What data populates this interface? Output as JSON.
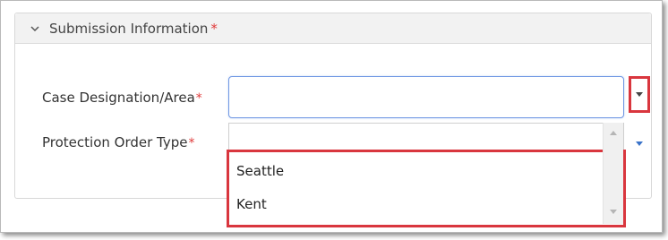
{
  "section": {
    "title": "Submission Information",
    "required_marker": "*"
  },
  "fields": {
    "case_designation": {
      "label": "Case Designation/Area",
      "required_marker": "*",
      "value": ""
    },
    "protection_order_type": {
      "label": "Protection Order Type",
      "required_marker": "*",
      "value": ""
    }
  },
  "dropdown_options": [
    "Seattle",
    "Kent"
  ],
  "icons": {
    "section_toggle": "chevron-down-icon",
    "dropdown_caret": "caret-down-icon",
    "order_type_caret": "caret-down-icon",
    "scroll_up": "scroll-up-arrow-icon",
    "scroll_down": "scroll-down-arrow-icon"
  },
  "colors": {
    "required": "#e03b3b",
    "highlight": "#d9363e",
    "focus_border": "#6f97e3",
    "caret_blue": "#3a73c9"
  }
}
